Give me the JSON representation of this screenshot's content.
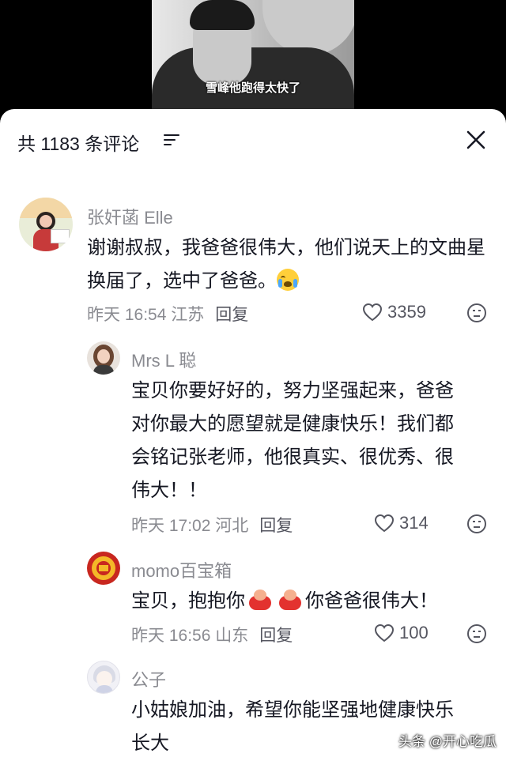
{
  "video": {
    "subtitle": "雪峰他跑得太快了"
  },
  "header": {
    "comment_count": "共 1183 条评论",
    "sort_icon": "filter-lines-icon",
    "close_icon": "close-icon"
  },
  "comments": [
    {
      "name": "张奸菡 Elle",
      "text": "谢谢叔叔，我爸爸很伟大，他们说天上的文曲星换届了，选中了爸爸。",
      "time": "昨天 16:54 江苏",
      "reply": "回复",
      "likes": "3359"
    },
    {
      "name": "Mrs L 聪",
      "text": "宝贝你要好好的，努力坚强起来，爸爸对你最大的愿望就是健康快乐！我们都会铭记张老师，他很真实、很优秀、很伟大！！",
      "time": "昨天 17:02 河北",
      "reply": "回复",
      "likes": "314"
    },
    {
      "name": "momo百宝箱",
      "text_before": "宝贝，抱抱你",
      "text_after": "你爸爸很伟大！",
      "time": "昨天 16:56 山东",
      "reply": "回复",
      "likes": "100"
    },
    {
      "name": "公子",
      "text": "小姑娘加油，希望你能坚强地健康快乐长大"
    }
  ],
  "watermark": "头条 @开心吃瓜",
  "colors": {
    "panel": "#ffffff",
    "text": "#161823",
    "secondary": "#8a8b91"
  }
}
